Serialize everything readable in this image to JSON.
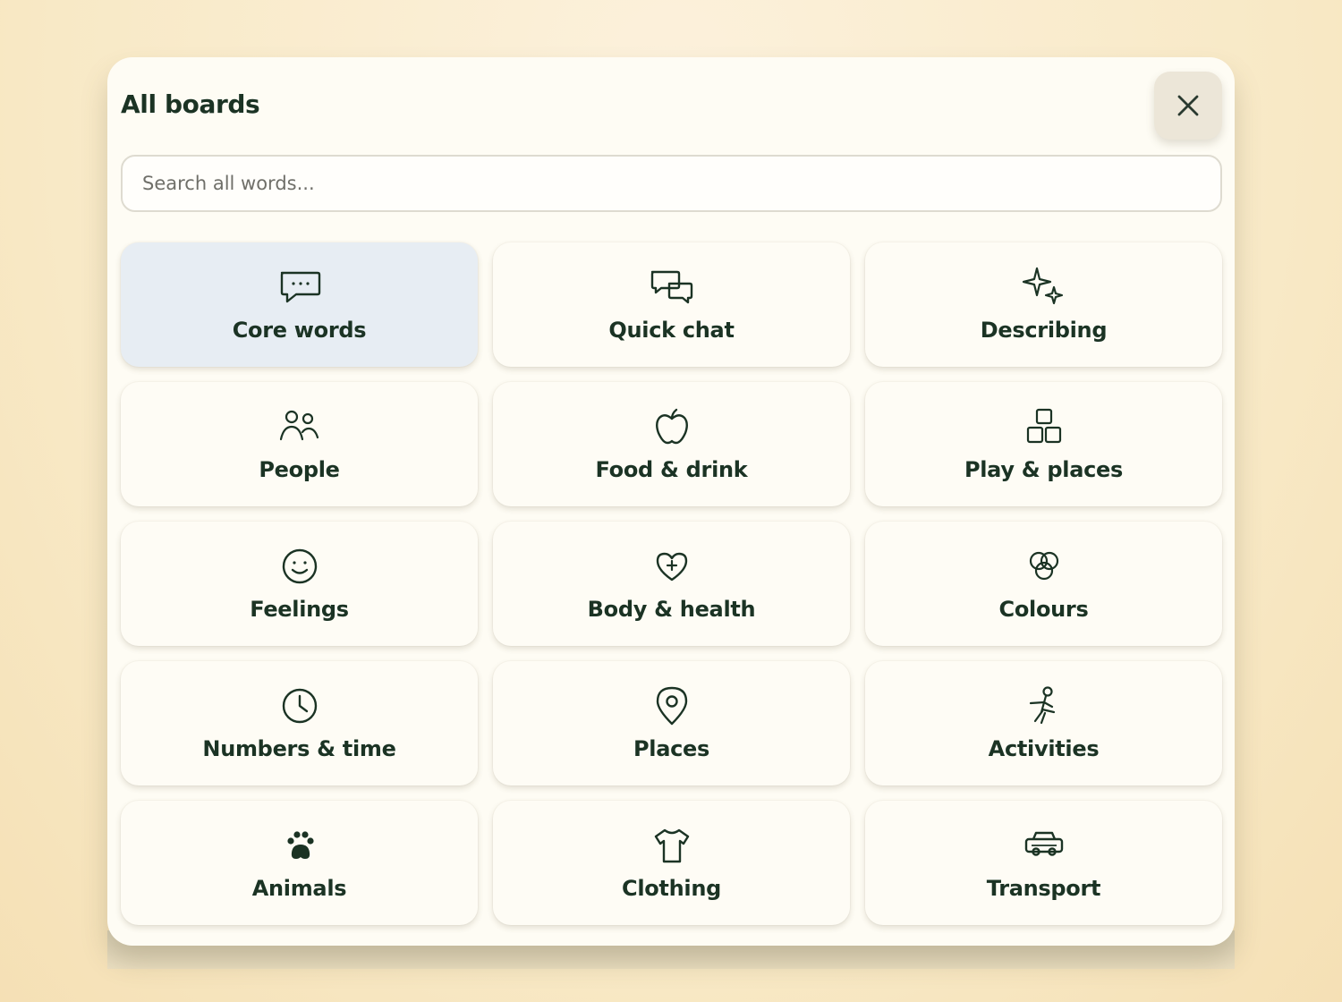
{
  "header": {
    "title": "All boards",
    "close_icon": "close-icon"
  },
  "search": {
    "placeholder": "Search all words...",
    "value": ""
  },
  "boards": [
    {
      "label": "Core words",
      "icon": "speech-bubble-icon",
      "selected": true
    },
    {
      "label": "Quick chat",
      "icon": "chat-bubbles-icon",
      "selected": false
    },
    {
      "label": "Describing",
      "icon": "sparkles-icon",
      "selected": false
    },
    {
      "label": "People",
      "icon": "people-icon",
      "selected": false
    },
    {
      "label": "Food & drink",
      "icon": "apple-icon",
      "selected": false
    },
    {
      "label": "Play & places",
      "icon": "blocks-icon",
      "selected": false
    },
    {
      "label": "Feelings",
      "icon": "smiley-icon",
      "selected": false
    },
    {
      "label": "Body & health",
      "icon": "heart-plus-icon",
      "selected": false
    },
    {
      "label": "Colours",
      "icon": "color-circles-icon",
      "selected": false
    },
    {
      "label": "Numbers & time",
      "icon": "clock-icon",
      "selected": false
    },
    {
      "label": "Places",
      "icon": "map-pin-icon",
      "selected": false
    },
    {
      "label": "Activities",
      "icon": "running-person-icon",
      "selected": false
    },
    {
      "label": "Animals",
      "icon": "paw-icon",
      "selected": false
    },
    {
      "label": "Clothing",
      "icon": "tshirt-icon",
      "selected": false
    },
    {
      "label": "Transport",
      "icon": "car-icon",
      "selected": false
    }
  ],
  "colors": {
    "text": "#1b3324",
    "selected_tile": "#e7edf3",
    "tile": "#fefcf5",
    "modal": "#fefcf4"
  }
}
